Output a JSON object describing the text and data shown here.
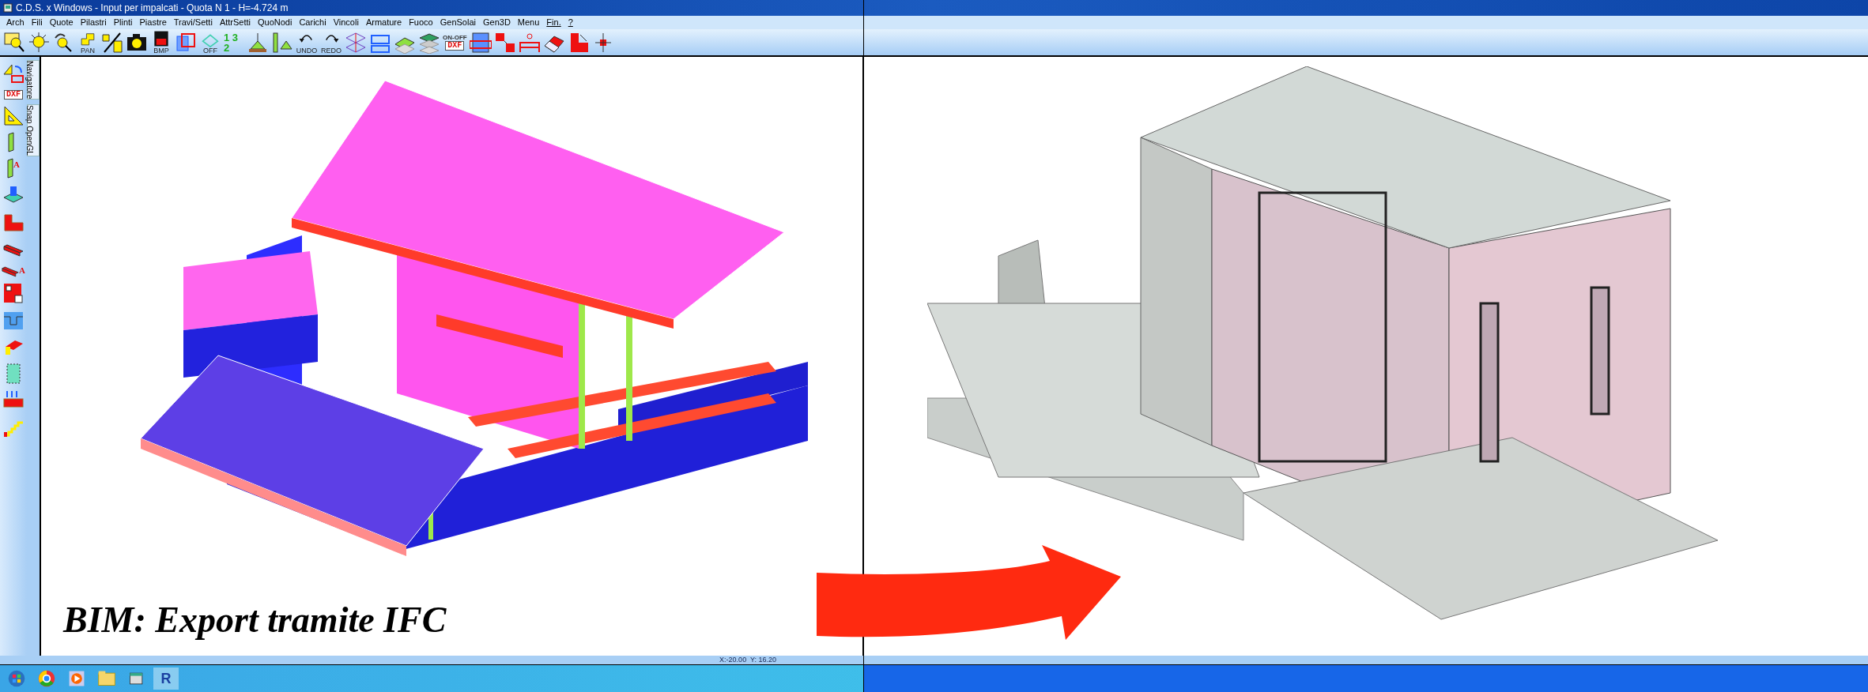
{
  "window": {
    "title": "C.D.S. x Windows - Input per impalcati - Quota N 1 - H=-4.724 m"
  },
  "menu": [
    {
      "label": "Arch",
      "underlined": false
    },
    {
      "label": "Fili",
      "underlined": false
    },
    {
      "label": "Quote",
      "underlined": false
    },
    {
      "label": "Pilastri",
      "underlined": false
    },
    {
      "label": "Plinti",
      "underlined": false
    },
    {
      "label": "Piastre",
      "underlined": false
    },
    {
      "label": "Travi/Setti",
      "underlined": false
    },
    {
      "label": "AttrSetti",
      "underlined": false
    },
    {
      "label": "QuoNodi",
      "underlined": false
    },
    {
      "label": "Carichi",
      "underlined": false
    },
    {
      "label": "Vincoli",
      "underlined": false
    },
    {
      "label": "Armature",
      "underlined": false
    },
    {
      "label": "Fuoco",
      "underlined": false
    },
    {
      "label": "GenSolai",
      "underlined": false
    },
    {
      "label": "Gen3D",
      "underlined": false
    },
    {
      "label": "Menu",
      "underlined": false
    },
    {
      "label": "Fin.",
      "underlined": true
    },
    {
      "label": "?",
      "underlined": true
    }
  ],
  "toolbar": [
    {
      "kind": "zoom-window"
    },
    {
      "kind": "zoom-all"
    },
    {
      "kind": "zoom-back"
    },
    {
      "kind": "pan",
      "label": "PAN"
    },
    {
      "kind": "cut"
    },
    {
      "kind": "camera"
    },
    {
      "kind": "disk",
      "label": "BMP"
    },
    {
      "kind": "frames"
    },
    {
      "kind": "plane",
      "label": "OFF"
    },
    {
      "kind": "numbers",
      "label": "1 3 2"
    },
    {
      "kind": "support"
    },
    {
      "kind": "column-supports"
    },
    {
      "kind": "undo",
      "label": "UNDO"
    },
    {
      "kind": "redo",
      "label": "REDO"
    },
    {
      "kind": "mesh"
    },
    {
      "kind": "frame-dims"
    },
    {
      "kind": "slab-layer"
    },
    {
      "kind": "layers"
    },
    {
      "kind": "document",
      "label": "DXF",
      "top": "ON-OFF"
    },
    {
      "kind": "building"
    },
    {
      "kind": "grid-red"
    },
    {
      "kind": "bed"
    },
    {
      "kind": "eraser"
    },
    {
      "kind": "corner"
    },
    {
      "kind": "axes"
    }
  ],
  "side_toolbar": [
    {
      "kind": "rotate"
    },
    {
      "kind": "document",
      "label": "DXF"
    },
    {
      "kind": "setsquare"
    },
    {
      "kind": "column"
    },
    {
      "kind": "column",
      "label": "A"
    },
    {
      "kind": "footing"
    },
    {
      "kind": "slab-l"
    },
    {
      "kind": "beam"
    },
    {
      "kind": "beam",
      "label": "A"
    },
    {
      "kind": "wall"
    },
    {
      "kind": "section"
    },
    {
      "kind": "stair-slab"
    },
    {
      "kind": "panel"
    },
    {
      "kind": "load-beam"
    },
    {
      "kind": "stair"
    }
  ],
  "side_tabs": [
    {
      "label": "Navigatore"
    },
    {
      "label": "Snap OpenGL"
    }
  ],
  "caption": "BIM: Export tramite IFC",
  "status_bar": {
    "coordinates": "X:-20.00  Y: 16.20"
  },
  "taskbar": [
    {
      "kind": "start"
    },
    {
      "kind": "browser"
    },
    {
      "kind": "media"
    },
    {
      "kind": "folder"
    },
    {
      "kind": "app"
    },
    {
      "kind": "letter",
      "label": "R"
    }
  ]
}
